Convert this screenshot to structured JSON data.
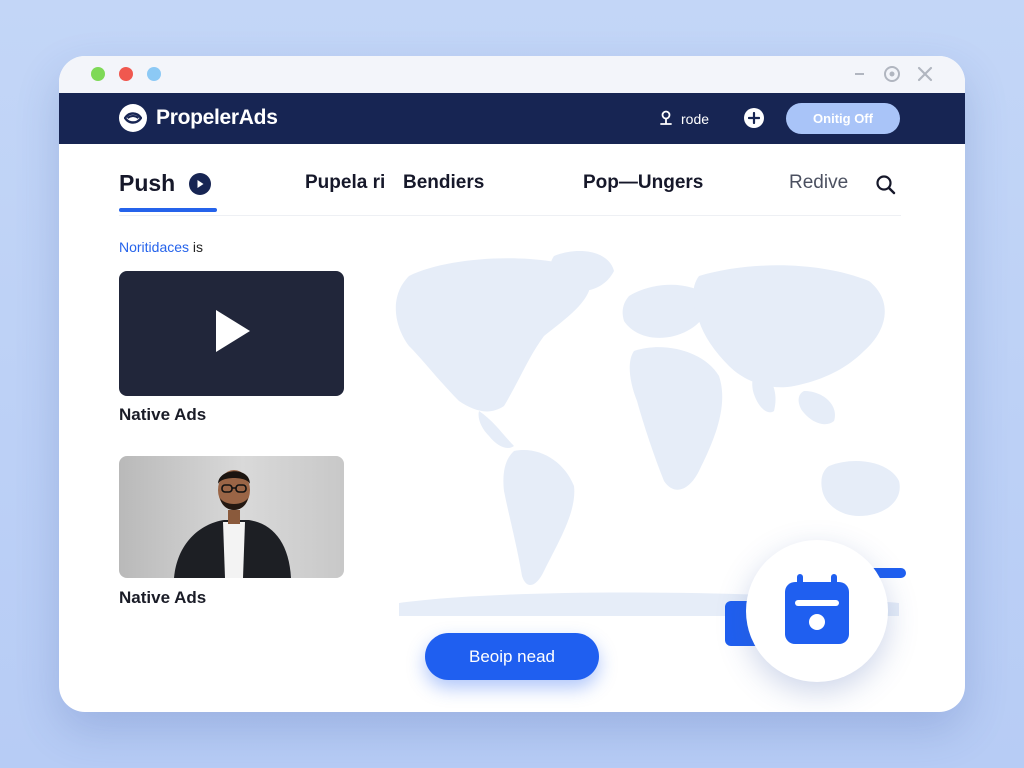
{
  "colors": {
    "background": "#c3d6f7",
    "navbar": "#172553",
    "accent": "#2563eb",
    "cta": "#1f5ff0",
    "nav_button": "#a9c4f8",
    "video_card": "#21263a",
    "map": "#e6edf8"
  },
  "window": {
    "controls": [
      "minimize-icon",
      "help-icon",
      "close-icon"
    ]
  },
  "navbar": {
    "brand": "PropelerAds",
    "brand_icon": "propeller-logo-icon",
    "user_label": "rode",
    "user_icon": "user-pin-icon",
    "plus_icon": "plus-circle-icon",
    "button_label": "Onitig Off"
  },
  "tabs": {
    "active": "Push",
    "active_icon": "play-circle-icon",
    "items": [
      "Pupela ri",
      "Bendiers",
      "Pop—Ungers",
      "Redive"
    ],
    "search_icon": "search-icon"
  },
  "section": {
    "label_highlight": "Noritidaces",
    "label_rest": " is"
  },
  "cards": [
    {
      "caption": "Native Ads",
      "media": "video",
      "icon": "play-icon"
    },
    {
      "caption": "Native Ads",
      "media": "photo"
    }
  ],
  "cta": {
    "label": "Beoip nead"
  },
  "floating": {
    "icon": "calendar-icon"
  }
}
